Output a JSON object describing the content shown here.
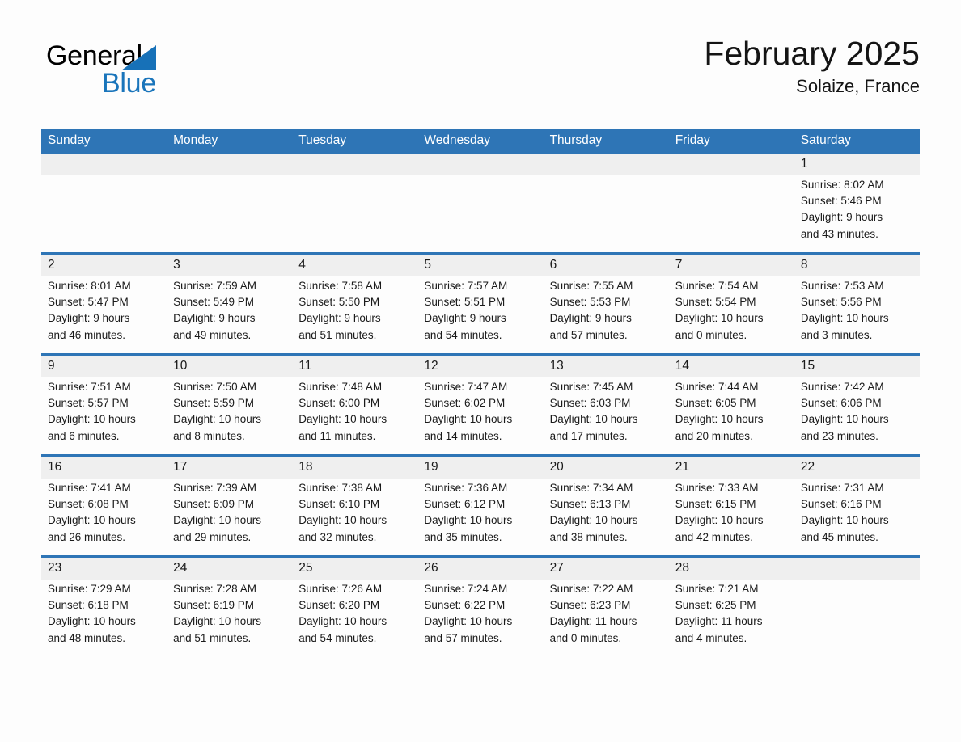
{
  "brand": {
    "word_one": "General",
    "word_two": "Blue"
  },
  "header": {
    "title": "February 2025",
    "location": "Solaize, France"
  },
  "weekdays": [
    "Sunday",
    "Monday",
    "Tuesday",
    "Wednesday",
    "Thursday",
    "Friday",
    "Saturday"
  ],
  "colors": {
    "header_blue": "#2e75b6",
    "row_divider_blue": "#2e75b6",
    "number_band_gray": "#efefef",
    "logo_blue": "#1a75bb",
    "text": "#1a1a1a"
  },
  "weeks": [
    [
      {
        "day": "",
        "lines": []
      },
      {
        "day": "",
        "lines": []
      },
      {
        "day": "",
        "lines": []
      },
      {
        "day": "",
        "lines": []
      },
      {
        "day": "",
        "lines": []
      },
      {
        "day": "",
        "lines": []
      },
      {
        "day": "1",
        "lines": [
          "Sunrise: 8:02 AM",
          "Sunset: 5:46 PM",
          "Daylight: 9 hours",
          "and 43 minutes."
        ]
      }
    ],
    [
      {
        "day": "2",
        "lines": [
          "Sunrise: 8:01 AM",
          "Sunset: 5:47 PM",
          "Daylight: 9 hours",
          "and 46 minutes."
        ]
      },
      {
        "day": "3",
        "lines": [
          "Sunrise: 7:59 AM",
          "Sunset: 5:49 PM",
          "Daylight: 9 hours",
          "and 49 minutes."
        ]
      },
      {
        "day": "4",
        "lines": [
          "Sunrise: 7:58 AM",
          "Sunset: 5:50 PM",
          "Daylight: 9 hours",
          "and 51 minutes."
        ]
      },
      {
        "day": "5",
        "lines": [
          "Sunrise: 7:57 AM",
          "Sunset: 5:51 PM",
          "Daylight: 9 hours",
          "and 54 minutes."
        ]
      },
      {
        "day": "6",
        "lines": [
          "Sunrise: 7:55 AM",
          "Sunset: 5:53 PM",
          "Daylight: 9 hours",
          "and 57 minutes."
        ]
      },
      {
        "day": "7",
        "lines": [
          "Sunrise: 7:54 AM",
          "Sunset: 5:54 PM",
          "Daylight: 10 hours",
          "and 0 minutes."
        ]
      },
      {
        "day": "8",
        "lines": [
          "Sunrise: 7:53 AM",
          "Sunset: 5:56 PM",
          "Daylight: 10 hours",
          "and 3 minutes."
        ]
      }
    ],
    [
      {
        "day": "9",
        "lines": [
          "Sunrise: 7:51 AM",
          "Sunset: 5:57 PM",
          "Daylight: 10 hours",
          "and 6 minutes."
        ]
      },
      {
        "day": "10",
        "lines": [
          "Sunrise: 7:50 AM",
          "Sunset: 5:59 PM",
          "Daylight: 10 hours",
          "and 8 minutes."
        ]
      },
      {
        "day": "11",
        "lines": [
          "Sunrise: 7:48 AM",
          "Sunset: 6:00 PM",
          "Daylight: 10 hours",
          "and 11 minutes."
        ]
      },
      {
        "day": "12",
        "lines": [
          "Sunrise: 7:47 AM",
          "Sunset: 6:02 PM",
          "Daylight: 10 hours",
          "and 14 minutes."
        ]
      },
      {
        "day": "13",
        "lines": [
          "Sunrise: 7:45 AM",
          "Sunset: 6:03 PM",
          "Daylight: 10 hours",
          "and 17 minutes."
        ]
      },
      {
        "day": "14",
        "lines": [
          "Sunrise: 7:44 AM",
          "Sunset: 6:05 PM",
          "Daylight: 10 hours",
          "and 20 minutes."
        ]
      },
      {
        "day": "15",
        "lines": [
          "Sunrise: 7:42 AM",
          "Sunset: 6:06 PM",
          "Daylight: 10 hours",
          "and 23 minutes."
        ]
      }
    ],
    [
      {
        "day": "16",
        "lines": [
          "Sunrise: 7:41 AM",
          "Sunset: 6:08 PM",
          "Daylight: 10 hours",
          "and 26 minutes."
        ]
      },
      {
        "day": "17",
        "lines": [
          "Sunrise: 7:39 AM",
          "Sunset: 6:09 PM",
          "Daylight: 10 hours",
          "and 29 minutes."
        ]
      },
      {
        "day": "18",
        "lines": [
          "Sunrise: 7:38 AM",
          "Sunset: 6:10 PM",
          "Daylight: 10 hours",
          "and 32 minutes."
        ]
      },
      {
        "day": "19",
        "lines": [
          "Sunrise: 7:36 AM",
          "Sunset: 6:12 PM",
          "Daylight: 10 hours",
          "and 35 minutes."
        ]
      },
      {
        "day": "20",
        "lines": [
          "Sunrise: 7:34 AM",
          "Sunset: 6:13 PM",
          "Daylight: 10 hours",
          "and 38 minutes."
        ]
      },
      {
        "day": "21",
        "lines": [
          "Sunrise: 7:33 AM",
          "Sunset: 6:15 PM",
          "Daylight: 10 hours",
          "and 42 minutes."
        ]
      },
      {
        "day": "22",
        "lines": [
          "Sunrise: 7:31 AM",
          "Sunset: 6:16 PM",
          "Daylight: 10 hours",
          "and 45 minutes."
        ]
      }
    ],
    [
      {
        "day": "23",
        "lines": [
          "Sunrise: 7:29 AM",
          "Sunset: 6:18 PM",
          "Daylight: 10 hours",
          "and 48 minutes."
        ]
      },
      {
        "day": "24",
        "lines": [
          "Sunrise: 7:28 AM",
          "Sunset: 6:19 PM",
          "Daylight: 10 hours",
          "and 51 minutes."
        ]
      },
      {
        "day": "25",
        "lines": [
          "Sunrise: 7:26 AM",
          "Sunset: 6:20 PM",
          "Daylight: 10 hours",
          "and 54 minutes."
        ]
      },
      {
        "day": "26",
        "lines": [
          "Sunrise: 7:24 AM",
          "Sunset: 6:22 PM",
          "Daylight: 10 hours",
          "and 57 minutes."
        ]
      },
      {
        "day": "27",
        "lines": [
          "Sunrise: 7:22 AM",
          "Sunset: 6:23 PM",
          "Daylight: 11 hours",
          "and 0 minutes."
        ]
      },
      {
        "day": "28",
        "lines": [
          "Sunrise: 7:21 AM",
          "Sunset: 6:25 PM",
          "Daylight: 11 hours",
          "and 4 minutes."
        ]
      },
      {
        "day": "",
        "lines": []
      }
    ]
  ]
}
